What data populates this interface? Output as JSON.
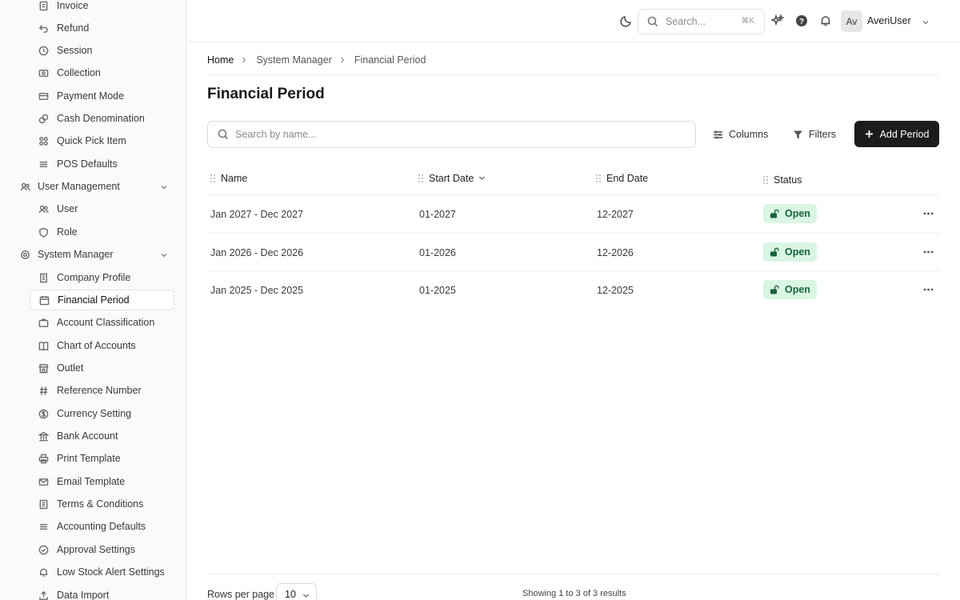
{
  "sidebar": {
    "items": [
      {
        "label": "Invoice",
        "icon": "invoice-icon"
      },
      {
        "label": "Refund",
        "icon": "refund-icon"
      },
      {
        "label": "Session",
        "icon": "clock-icon"
      },
      {
        "label": "Collection",
        "icon": "collection-icon"
      },
      {
        "label": "Payment Mode",
        "icon": "card-icon"
      },
      {
        "label": "Cash Denomination",
        "icon": "coins-icon"
      },
      {
        "label": "Quick Pick Item",
        "icon": "grid-icon"
      },
      {
        "label": "POS Defaults",
        "icon": "sliders-icon"
      }
    ],
    "user_management": {
      "label": "User Management",
      "items": [
        {
          "label": "User",
          "icon": "users-icon"
        },
        {
          "label": "Role",
          "icon": "shield-icon"
        }
      ]
    },
    "system_manager": {
      "label": "System Manager",
      "items": [
        {
          "label": "Company Profile",
          "icon": "building-icon"
        },
        {
          "label": "Financial Period",
          "icon": "calendar-icon"
        },
        {
          "label": "Account Classification",
          "icon": "briefcase-icon"
        },
        {
          "label": "Chart of Accounts",
          "icon": "book-icon"
        },
        {
          "label": "Outlet",
          "icon": "store-icon"
        },
        {
          "label": "Reference Number",
          "icon": "hash-icon"
        },
        {
          "label": "Currency Setting",
          "icon": "dollar-icon"
        },
        {
          "label": "Bank Account",
          "icon": "bank-icon"
        },
        {
          "label": "Print Template",
          "icon": "printer-icon"
        },
        {
          "label": "Email Template",
          "icon": "mail-icon"
        },
        {
          "label": "Terms & Conditions",
          "icon": "document-icon"
        },
        {
          "label": "Accounting Defaults",
          "icon": "sliders-icon"
        },
        {
          "label": "Approval Settings",
          "icon": "check-circle-icon"
        },
        {
          "label": "Low Stock Alert Settings",
          "icon": "bell-icon"
        },
        {
          "label": "Data Import",
          "icon": "upload-icon"
        }
      ]
    }
  },
  "topbar": {
    "search_placeholder": "Search...",
    "search_shortcut": "⌘K",
    "avatar_initials": "Av",
    "user_name": "AveriUser"
  },
  "breadcrumb": [
    "Home",
    "System Manager",
    "Financial Period"
  ],
  "page": {
    "title": "Financial Period",
    "search_placeholder": "Search by name...",
    "columns_label": "Columns",
    "filters_label": "Filters",
    "add_label": "Add Period"
  },
  "table": {
    "headers": [
      "Name",
      "Start Date",
      "End Date",
      "Status"
    ],
    "rows": [
      {
        "name": "Jan 2027 - Dec 2027",
        "start": "01-2027",
        "end": "12-2027",
        "status": "Open"
      },
      {
        "name": "Jan 2026 - Dec 2026",
        "start": "01-2026",
        "end": "12-2026",
        "status": "Open"
      },
      {
        "name": "Jan 2025 - Dec 2025",
        "start": "01-2025",
        "end": "12-2025",
        "status": "Open"
      }
    ]
  },
  "footer": {
    "rows_per_page_label": "Rows per page",
    "rows_per_page_value": "10",
    "results_text": "Showing 1 to 3 of 3 results"
  },
  "colors": {
    "primary_button": "#1c1c1c",
    "badge_bg": "#d9f5e3",
    "badge_text": "#18643a"
  }
}
